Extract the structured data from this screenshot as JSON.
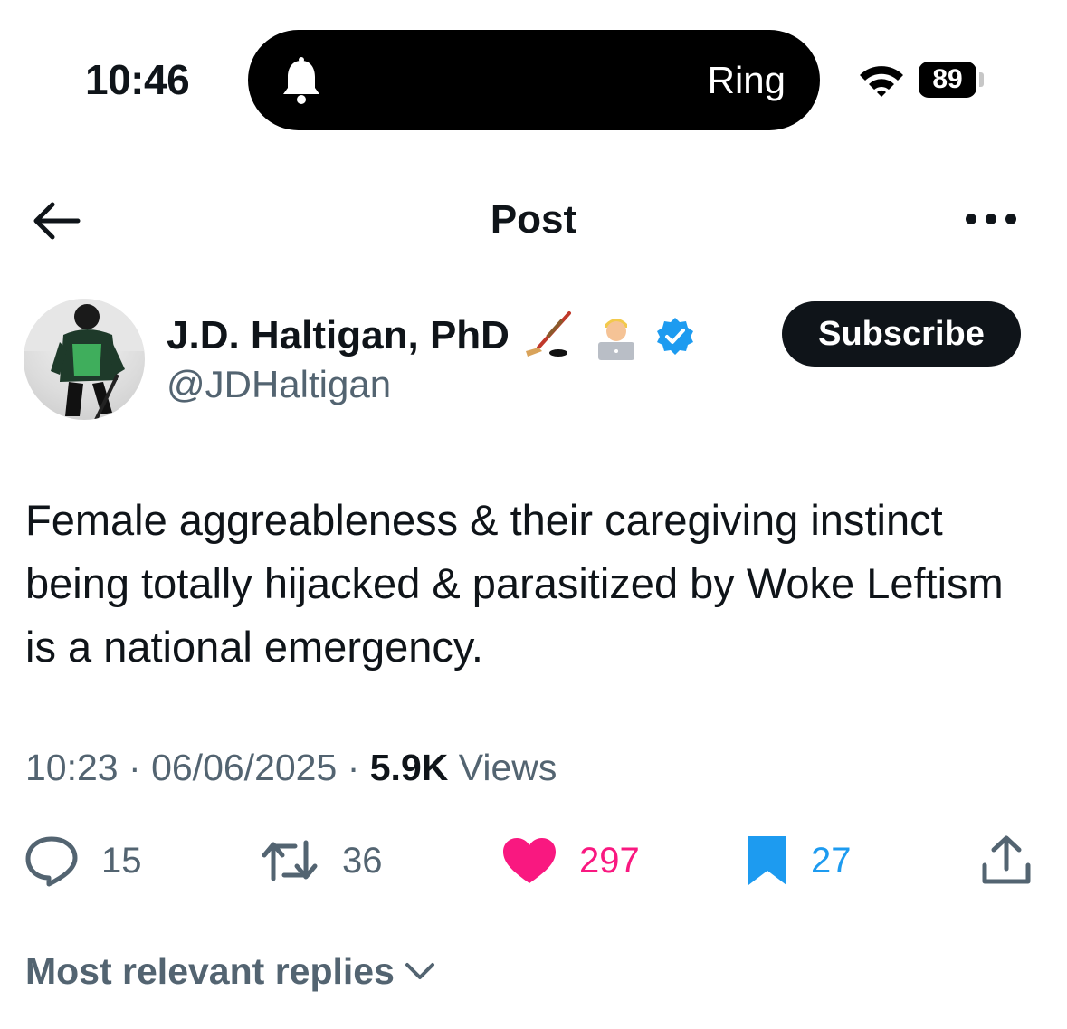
{
  "status_bar": {
    "time": "10:46",
    "island_label": "Ring",
    "battery": "89",
    "icons": [
      "bell-icon",
      "wifi-icon",
      "battery-icon"
    ]
  },
  "header": {
    "title": "Post",
    "icons": [
      "back-arrow-icon",
      "more-icon"
    ]
  },
  "author": {
    "name": "J.D. Haltigan, PhD",
    "handle": "@JDHaltigan",
    "name_emojis": [
      "hockey-stick-icon",
      "man-technologist-icon"
    ],
    "verified_icon": "verified-badge-icon",
    "subscribe_label": "Subscribe"
  },
  "post": {
    "text": "Female aggreableness & their caregiving instinct being totally hijacked & parasitized by Woke Leftism is a national emergency.",
    "time": "10:23",
    "date": "06/06/2025",
    "views_count": "5.9K",
    "views_label": "Views",
    "separator": "·"
  },
  "actions": {
    "replies": "15",
    "reposts": "36",
    "likes": "297",
    "bookmarks": "27",
    "icons": [
      "reply-icon",
      "repost-icon",
      "heart-icon",
      "bookmark-icon",
      "share-icon"
    ]
  },
  "replies_sort": {
    "label": "Most relevant replies"
  },
  "colors": {
    "text": "#0f1419",
    "secondary": "#536471",
    "like": "#f91880",
    "bookmark": "#1d9bf0",
    "verified": "#1d9bf0"
  }
}
